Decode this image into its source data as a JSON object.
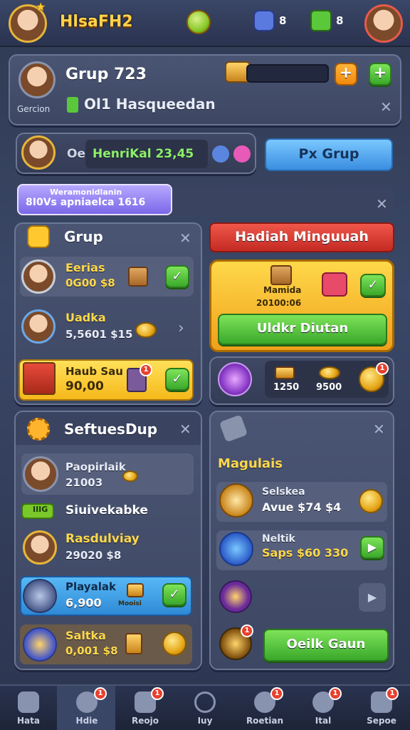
{
  "topbar": {
    "title": "HlsaFH2",
    "gems_count": "8",
    "gifts_count": "8"
  },
  "group_header": {
    "name": "Grup 723",
    "player_label": "Gercion",
    "status": "Ol1 Hasqueedan"
  },
  "invite_row": {
    "prefix": "Oe",
    "name_value": "HenriKal 23,45",
    "button": "Px Grup"
  },
  "tooltip": {
    "line1": "Weramonidlanin",
    "line2": "8I0Vs apniaelca 1616"
  },
  "grup_panel": {
    "title": "Grup",
    "members": [
      {
        "name": "Eerias",
        "value": "0G00 $8"
      },
      {
        "name": "Uadka",
        "value": "5,5601 $15"
      },
      {
        "name": "Haub Sau",
        "value": "90,00"
      }
    ]
  },
  "reward_panel": {
    "title": "Hadiah Minguuah",
    "item_label": "Mamida",
    "item_value": "20100:06",
    "claim_button": "Uldkr Diutan",
    "stat1": "1250",
    "stat2": "9500"
  },
  "settings_panel": {
    "title": "SeftuesDup",
    "entries": [
      {
        "name": "Paopirlaik",
        "value": "21003"
      },
      {
        "name": "Siuivekabke",
        "value": ""
      },
      {
        "name": "Rasdulviay",
        "value": "29020 $8"
      },
      {
        "name": "Playalak",
        "value": "6,900"
      },
      {
        "name": "Saltka",
        "value": "0,001 $8"
      }
    ],
    "tag1": "IIIG",
    "extra_label": "Mooisi"
  },
  "magulais_panel": {
    "title": "Magulais",
    "items": [
      {
        "name": "Selskea",
        "value": "Avue $74 $4"
      },
      {
        "name": "Neltik",
        "value": "Saps $60 330"
      }
    ],
    "button": "Oeilk Gaun"
  },
  "bottom_nav": {
    "items": [
      "Hata",
      "Hdie",
      "Reojo",
      "Iuy",
      "Roetian",
      "Ital",
      "Sepoe"
    ],
    "badges": [
      "1",
      "1",
      "1",
      "1",
      "1"
    ]
  },
  "colors": {
    "accent_gold": "#ffd34a",
    "accent_green": "#3aa82a",
    "panel_bg": "#4a5573"
  }
}
